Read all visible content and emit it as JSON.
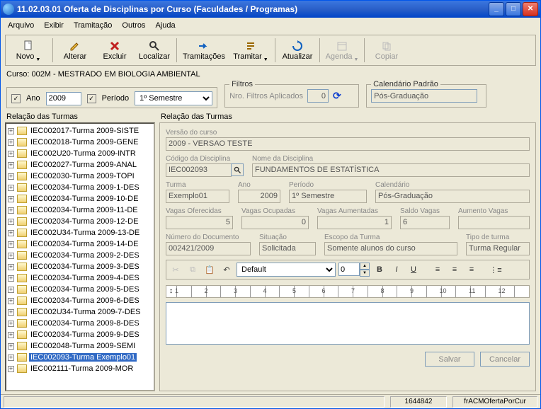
{
  "window": {
    "title": "11.02.03.01 Oferta de Disciplinas por Curso (Faculdades / Programas)"
  },
  "menu": [
    "Arquivo",
    "Exibir",
    "Tramitação",
    "Outros",
    "Ajuda"
  ],
  "toolbar": {
    "novo": "Novo",
    "alterar": "Alterar",
    "excluir": "Excluir",
    "localizar": "Localizar",
    "tramitacoes": "Tramitações",
    "tramitar": "Tramitar",
    "atualizar": "Atualizar",
    "agenda": "Agenda",
    "copiar": "Copiar"
  },
  "curso_line": "Curso: 002M - MESTRADO EM BIOLOGIA AMBIENTAL",
  "params": {
    "ano_label": "Ano",
    "ano_value": "2009",
    "periodo_label": "Período",
    "periodo_value": "1º Semestre"
  },
  "filtros": {
    "legend": "Filtros",
    "label": "Nro. Filtros Aplicados",
    "value": "0"
  },
  "calendario": {
    "legend": "Calendário Padrão",
    "value": "Pós-Graduação"
  },
  "tree_title": "Relação das Turmas",
  "tree_items": [
    "IEC002017-Turma 2009-SISTE",
    "IEC002018-Turma 2009-GENE",
    "IEC002U20-Turma 2009-INTR",
    "IEC002027-Turma 2009-ANAL",
    "IEC002030-Turma 2009-TOPI",
    "IEC002034-Turma 2009-1-DES",
    "IEC002034-Turma 2009-10-DE",
    "IEC002034-Turma 2009-11-DE",
    "IEC002034-Turma 2009-12-DE",
    "IEC002U34-Turma 2009-13-DE",
    "IEC002034-Turma 2009-14-DE",
    "IEC002034-Turma 2009-2-DES",
    "IEC002034-Turma 2009-3-DES",
    "IEC002034-Turma 2009-4-DES",
    "IEC002034-Turma 2009-5-DES",
    "IEC002034-Turma 2009-6-DES",
    "IEC002U34-Turma 2009-7-DES",
    "IEC002034-Turma 2009-8-DES",
    "IEC002034-Turma 2009-9-DES",
    "IEC002048-Turma 2009-SEMI",
    "IEC002093-Turma Exemplo01",
    "IEC002111-Turma 2009-MOR"
  ],
  "tree_selected_index": 20,
  "detail_title": "Relação das Turmas",
  "form": {
    "versao_label": "Versão do curso",
    "versao_value": "2009 - VERSAO TESTE",
    "codigo_label": "Código da Disciplina",
    "codigo_value": "IEC002093",
    "nome_label": "Nome da Disciplina",
    "nome_value": "FUNDAMENTOS DE ESTATÍSTICA",
    "turma_label": "Turma",
    "turma_value": "Exemplo01",
    "ano_label": "Ano",
    "ano_value": "2009",
    "periodo_label": "Período",
    "periodo_value": "1º Semestre",
    "calendario_label": "Calendário",
    "calendario_value": "Pós-Graduação",
    "vagas_oferecidas_label": "Vagas Oferecidas",
    "vagas_oferecidas_value": "5",
    "vagas_ocupadas_label": "Vagas Ocupadas",
    "vagas_ocupadas_value": "0",
    "vagas_aumentadas_label": "Vagas Aumentadas",
    "vagas_aumentadas_value": "1",
    "saldo_vagas_label": "Saldo Vagas",
    "saldo_vagas_value": "6",
    "aumento_vagas_label": "Aumento Vagas",
    "aumento_vagas_value": "",
    "numdoc_label": "Número do Documento",
    "numdoc_value": "002421/2009",
    "situacao_label": "Situação",
    "situacao_value": "Solicitada",
    "escopo_label": "Escopo da Turma",
    "escopo_value": "Somente alunos do curso",
    "tipo_label": "Tipo de turma",
    "tipo_value": "Turma Regular"
  },
  "editor": {
    "font": "Default",
    "size": "0"
  },
  "buttons": {
    "salvar": "Salvar",
    "cancelar": "Cancelar"
  },
  "status": {
    "num": "1644842",
    "form": "frACMOfertaPorCur"
  }
}
